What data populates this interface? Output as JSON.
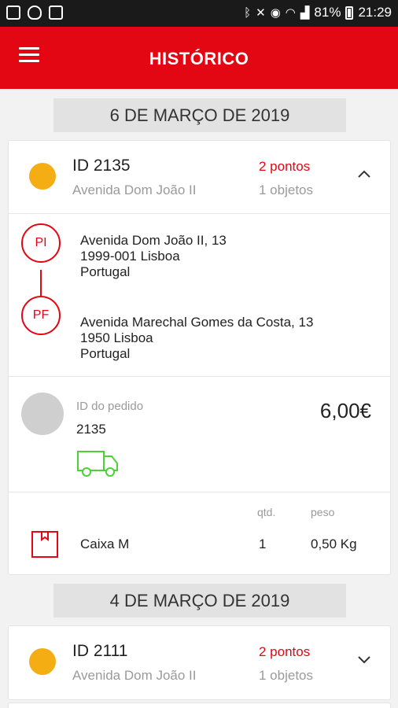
{
  "status_bar": {
    "left_icons": [
      "image-icon",
      "shield-icon",
      "gallery-icon"
    ],
    "right_icons": [
      "bluetooth-icon",
      "mute-icon",
      "alarm-icon",
      "wifi-icon",
      "signal-icon"
    ],
    "battery": "81%",
    "time": "21:29"
  },
  "app_bar": {
    "title": "HISTÓRICO",
    "color": "#e30613"
  },
  "groups": [
    {
      "date": "6 DE MARÇO DE 2019",
      "order": {
        "id": "ID 2135",
        "street": "Avenida Dom João II",
        "points": "2 pontos",
        "objects": "1 objetos",
        "status_color": "#f4ad13",
        "expanded": true,
        "pickup": {
          "badge": "PI",
          "line1": "Avenida Dom João II, 13",
          "line2": "1999-001 Lisboa",
          "line3": "Portugal"
        },
        "dropoff": {
          "badge": "PF",
          "line1": "Avenida Marechal Gomes da Costa, 13",
          "line2": "1950 Lisboa",
          "line3": "Portugal"
        },
        "payment": {
          "label": "ID do pedido",
          "order_id": "2135",
          "price": "6,00€",
          "vehicle_icon": "van-icon"
        },
        "items_header": {
          "qty": "qtd.",
          "weight": "peso"
        },
        "items": [
          {
            "name": "Caixa M",
            "qty": "1",
            "weight": "0,50 Kg",
            "icon": "box-icon"
          }
        ]
      }
    },
    {
      "date": "4 DE MARÇO DE 2019",
      "order": {
        "id": "ID 2111",
        "street": "Avenida Dom João II",
        "points": "2 pontos",
        "objects": "1 objetos",
        "status_color": "#f4ad13",
        "expanded": false
      }
    }
  ]
}
